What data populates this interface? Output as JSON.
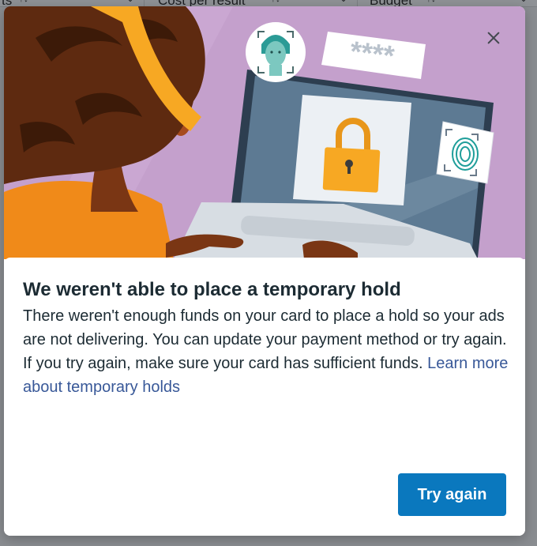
{
  "background": {
    "columns": [
      "ts",
      "Cost per result",
      "Budget"
    ]
  },
  "modal": {
    "title": "We weren't able to place a temporary hold",
    "body": "There weren't enough funds on your card to place a hold so your ads are not delivering. You can update your payment method or try again. If you try again, make sure your card has sufficient funds.",
    "link_text": "Learn more about temporary holds",
    "button_label": "Try again",
    "password_mask": "****"
  },
  "colors": {
    "accent": "#0a78be",
    "link": "#385898",
    "illustration_background": "#c4a0cc"
  },
  "icons": [
    "close-icon",
    "padlock-icon",
    "fingerprint-icon",
    "face-scan-icon",
    "password-icon"
  ]
}
